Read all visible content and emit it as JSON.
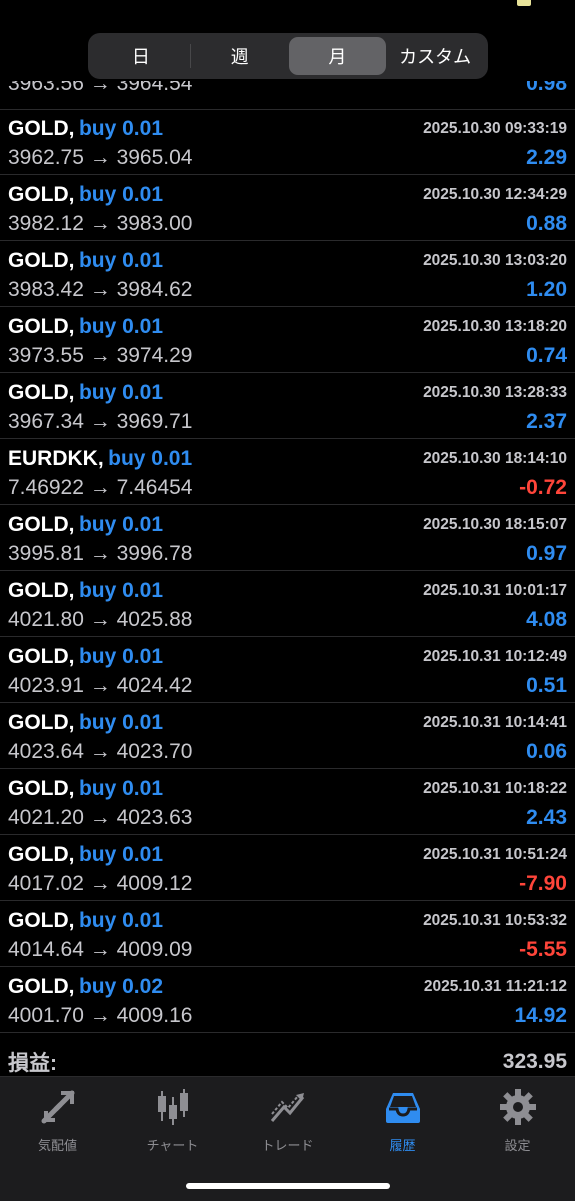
{
  "period_tabs": [
    "日",
    "週",
    "月",
    "カスタム"
  ],
  "selected_period": "月",
  "partial_row": {
    "prices": "3963.56 → 3964.54",
    "profit": "0.98"
  },
  "deals": [
    {
      "symbol": "GOLD,",
      "side": "buy 0.01",
      "time": "2025.10.30 09:33:19",
      "prices": "3962.75 → 3965.04",
      "profit": "2.29",
      "sign": "pos"
    },
    {
      "symbol": "GOLD,",
      "side": "buy 0.01",
      "time": "2025.10.30 12:34:29",
      "prices": "3982.12 → 3983.00",
      "profit": "0.88",
      "sign": "pos"
    },
    {
      "symbol": "GOLD,",
      "side": "buy 0.01",
      "time": "2025.10.30 13:03:20",
      "prices": "3983.42 → 3984.62",
      "profit": "1.20",
      "sign": "pos"
    },
    {
      "symbol": "GOLD,",
      "side": "buy 0.01",
      "time": "2025.10.30 13:18:20",
      "prices": "3973.55 → 3974.29",
      "profit": "0.74",
      "sign": "pos"
    },
    {
      "symbol": "GOLD,",
      "side": "buy 0.01",
      "time": "2025.10.30 13:28:33",
      "prices": "3967.34 → 3969.71",
      "profit": "2.37",
      "sign": "pos"
    },
    {
      "symbol": "EURDKK,",
      "side": "buy 0.01",
      "time": "2025.10.30 18:14:10",
      "prices": "7.46922 → 7.46454",
      "profit": "-0.72",
      "sign": "neg"
    },
    {
      "symbol": "GOLD,",
      "side": "buy 0.01",
      "time": "2025.10.30 18:15:07",
      "prices": "3995.81 → 3996.78",
      "profit": "0.97",
      "sign": "pos"
    },
    {
      "symbol": "GOLD,",
      "side": "buy 0.01",
      "time": "2025.10.31 10:01:17",
      "prices": "4021.80 → 4025.88",
      "profit": "4.08",
      "sign": "pos"
    },
    {
      "symbol": "GOLD,",
      "side": "buy 0.01",
      "time": "2025.10.31 10:12:49",
      "prices": "4023.91 → 4024.42",
      "profit": "0.51",
      "sign": "pos"
    },
    {
      "symbol": "GOLD,",
      "side": "buy 0.01",
      "time": "2025.10.31 10:14:41",
      "prices": "4023.64 → 4023.70",
      "profit": "0.06",
      "sign": "pos"
    },
    {
      "symbol": "GOLD,",
      "side": "buy 0.01",
      "time": "2025.10.31 10:18:22",
      "prices": "4021.20 → 4023.63",
      "profit": "2.43",
      "sign": "pos"
    },
    {
      "symbol": "GOLD,",
      "side": "buy 0.01",
      "time": "2025.10.31 10:51:24",
      "prices": "4017.02 → 4009.12",
      "profit": "-7.90",
      "sign": "neg"
    },
    {
      "symbol": "GOLD,",
      "side": "buy 0.01",
      "time": "2025.10.31 10:53:32",
      "prices": "4014.64 → 4009.09",
      "profit": "-5.55",
      "sign": "neg"
    },
    {
      "symbol": "GOLD,",
      "side": "buy 0.02",
      "time": "2025.10.31 11:21:12",
      "prices": "4001.70 → 4009.16",
      "profit": "14.92",
      "sign": "pos"
    }
  ],
  "total": {
    "label": "損益:",
    "value": "323.95"
  },
  "tabbar": {
    "items": [
      {
        "label": "気配値",
        "icon": "quotes-arrows-icon"
      },
      {
        "label": "チャート",
        "icon": "candlestick-chart-icon"
      },
      {
        "label": "トレード",
        "icon": "trade-chart-icon"
      },
      {
        "label": "履歴",
        "icon": "inbox-history-icon"
      },
      {
        "label": "設定",
        "icon": "gear-icon"
      }
    ],
    "active": "履歴"
  },
  "colors": {
    "profit_positive": "#2f8cf0",
    "profit_negative": "#ff453a",
    "active_tab": "#2f8cf0"
  }
}
